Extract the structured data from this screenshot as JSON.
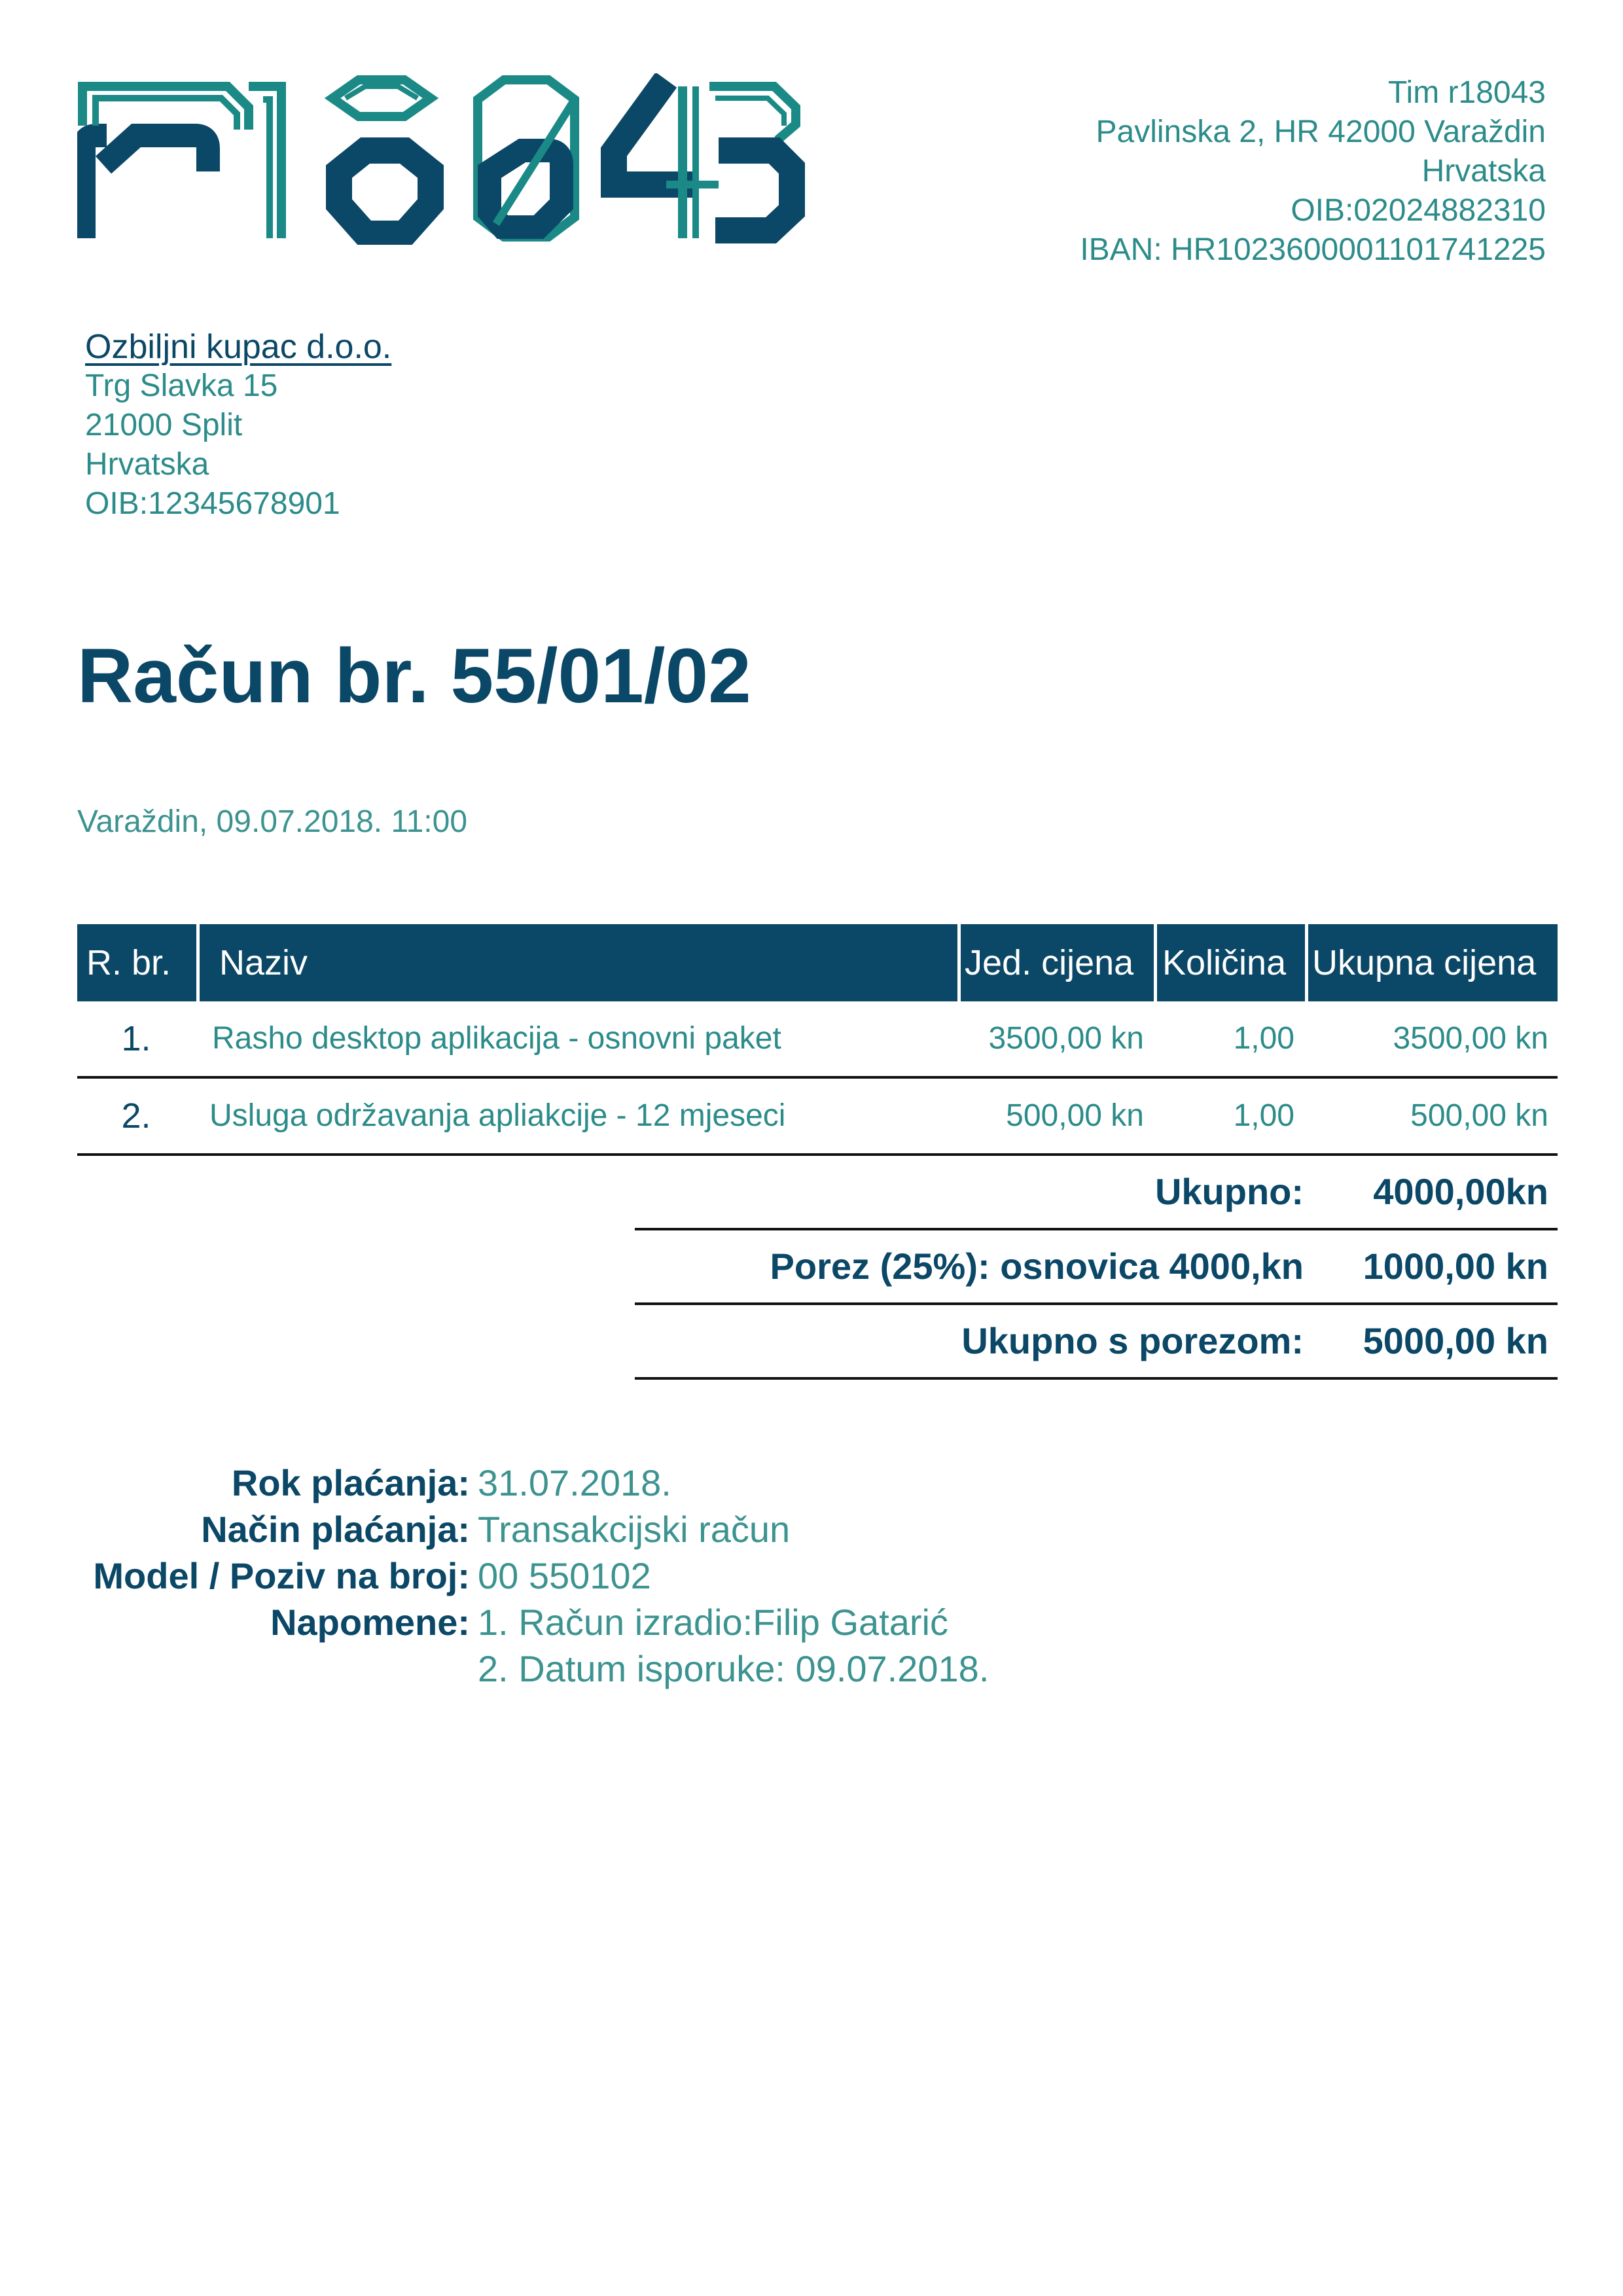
{
  "logo": {
    "text": "r18043",
    "colors": {
      "teal": "#1b8a86",
      "navy": "#0b4766"
    }
  },
  "sender": {
    "lines": [
      "Tim r18043",
      "Pavlinska 2, HR 42000 Varaždin",
      "Hrvatska",
      "OIB:02024882310",
      "IBAN: HR1023600001101741225"
    ]
  },
  "buyer": {
    "name": "Ozbiljni kupac d.o.o.",
    "lines": [
      "Trg Slavka 15",
      "21000 Split",
      "Hrvatska",
      "OIB:12345678901"
    ]
  },
  "invoice": {
    "title": "Račun br. 55/01/02",
    "place_date": "Varaždin, 09.07.2018. 11:00"
  },
  "table": {
    "headers": [
      "R. br.",
      "Naziv",
      "Jed. cijena",
      "Količina",
      "Ukupna cijena"
    ],
    "rows": [
      {
        "no": "1.",
        "name": "Rasho desktop aplikacija - osnovni paket",
        "unit_price": "3500,00 kn",
        "qty": "1,00",
        "total": "3500,00 kn"
      },
      {
        "no": "2.",
        "name": "Usluga održavanja apliakcije - 12 mjeseci",
        "unit_price": "500,00 kn",
        "qty": "1,00",
        "total": "500,00 kn"
      }
    ]
  },
  "summary": [
    {
      "label": "Ukupno:",
      "value": "4000,00kn"
    },
    {
      "label": "Porez (25%): osnovica 4000,kn",
      "value": "1000,00 kn"
    },
    {
      "label": "Ukupno s porezom:",
      "value": "5000,00 kn"
    }
  ],
  "payment": [
    {
      "label": "Rok plaćanja:",
      "value": "31.07.2018."
    },
    {
      "label": "Način plaćanja:",
      "value": "Transakcijski račun"
    },
    {
      "label": "Model / Poziv na broj:",
      "value": "00 550102"
    },
    {
      "label": "Napomene:",
      "value": "1. Račun izradio:Filip Gatarić"
    },
    {
      "label": "",
      "value": "2. Datum isporuke: 09.07.2018."
    }
  ],
  "colors": {
    "navy": "#0b4766",
    "teal": "#2c8c8a",
    "rule": "#111111"
  }
}
